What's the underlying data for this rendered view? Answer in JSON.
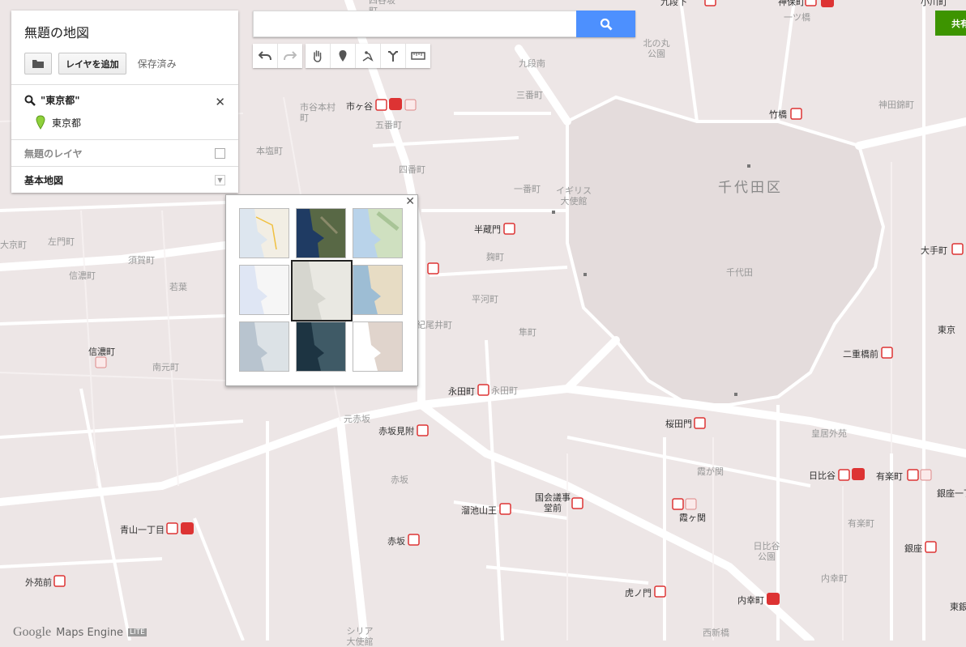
{
  "panel": {
    "map_title": "無題の地図",
    "add_layer_label": "レイヤを追加",
    "saved_label": "保存済み",
    "search_query": "\"東京都\"",
    "search_result": "東京都",
    "layer_name": "無題のレイヤ",
    "base_map_label": "基本地図"
  },
  "search": {
    "value": "",
    "placeholder": ""
  },
  "share_label": "共有",
  "footer": {
    "google": "Google",
    "maps_engine": "Maps Engine",
    "lite": "LITE"
  },
  "basemap_options": [
    {
      "id": "map",
      "selected": false
    },
    {
      "id": "satellite",
      "selected": false
    },
    {
      "id": "terrain",
      "selected": false
    },
    {
      "id": "light-political",
      "selected": false
    },
    {
      "id": "mono-city",
      "selected": true
    },
    {
      "id": "simple-atlas",
      "selected": false
    },
    {
      "id": "light-landmass",
      "selected": false
    },
    {
      "id": "dark-landmass",
      "selected": false
    },
    {
      "id": "whitewater",
      "selected": false
    }
  ],
  "map_labels": {
    "ichigaya": "市ヶ谷",
    "ichigaya_honmura": "市谷本村町",
    "gobancho": "五番町",
    "sanbancho": "三番町",
    "kudanminami": "九段南",
    "honshiocho": "本塩町",
    "yonbancho": "四番町",
    "ichibancho": "一番町",
    "takebashi": "竹橋",
    "kanda_nishikicho": "神田錦町",
    "chiyoda_ku": "千代田区",
    "chiyoda": "千代田",
    "hanzomon": "半蔵門",
    "kojimachi": "麹町",
    "hirakawacho": "平河町",
    "kioicho": "紀尾井町",
    "hayabusacho": "隼町",
    "nagatacho": "永田町",
    "nagatacho_area": "永田町",
    "motoakasaka": "元赤坂",
    "akasaka_mitsuke": "赤坂見附",
    "akasaka": "赤坂",
    "akasaka_station": "赤坂",
    "tameike_sanno": "溜池山王",
    "kokkai_gijidomae": "国会議事堂前",
    "sakuradamon": "桜田門",
    "kokyo_gaien": "皇居外苑",
    "kasumigaseki": "霞が関",
    "kasumigaseki_station": "霞ヶ関",
    "hibiya": "日比谷",
    "yurakucho": "有楽町",
    "hibiya_koen": "日比谷公園",
    "uchisaiwaicho_area": "内幸町",
    "uchisaiwaicho": "内幸町",
    "toranomon": "虎ノ門",
    "nishi_shinbashi": "西新橋",
    "niju_bashimae": "二重橋前",
    "otemachi": "大手町",
    "tokyo": "東京",
    "ginza": "銀座",
    "yurakucho_area": "有楽町",
    "shinanomachi": "信濃町",
    "minamimotomachi": "南元町",
    "sugacho": "須賀町",
    "wakaba": "若葉",
    "samoncho": "左門町",
    "shinanomachi_area": "信濃町",
    "daikyocho": "大京町",
    "aoyama_itchome": "青山一丁目",
    "gaienmae": "外苑前",
    "british_embassy": "イギリス大使館",
    "syria_embassy": "シリア大使館",
    "kitanomaru": "北の丸公園",
    "jimbocho": "神保町",
    "hitotsubashi": "一ツ橋",
    "kudanshita": "九段下",
    "ginza_itchome": "銀座一丁目",
    "higashi_ginza": "東銀座",
    "ogawamachi": "小川町",
    "yotsuya_sakamachi": "四谷坂町"
  }
}
